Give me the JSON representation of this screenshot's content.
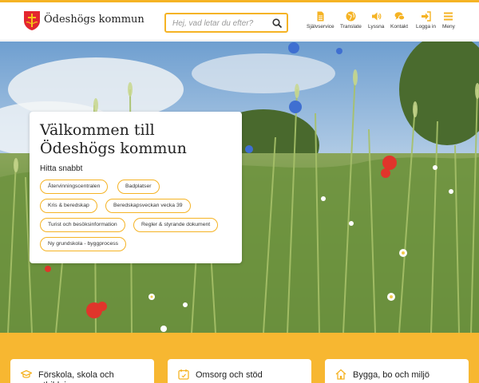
{
  "header": {
    "logo_text": "Ödeshögs kommun",
    "search_placeholder": "Hej, vad letar du efter?",
    "nav": [
      {
        "label": "Självservice",
        "icon": "document-icon"
      },
      {
        "label": "Translate",
        "icon": "globe-icon"
      },
      {
        "label": "Lyssna",
        "icon": "speaker-icon"
      },
      {
        "label": "Kontakt",
        "icon": "chat-icon"
      },
      {
        "label": "Logga in",
        "icon": "login-icon"
      },
      {
        "label": "Meny",
        "icon": "menu-icon"
      }
    ]
  },
  "hero": {
    "title": "Välkommen till Ödeshögs kommun",
    "subtitle": "Hitta snabbt",
    "chips": [
      "Återvinningscentralen",
      "Badplatser",
      "Kris & beredskap",
      "Beredskapsveckan vecka 39",
      "Turist och besöksinformation",
      "Regler & styrande dokument",
      "Ny grundskola - byggprocess"
    ]
  },
  "tiles": [
    {
      "label": "Förskola, skola och utbildning",
      "icon": "graduation-cap-icon"
    },
    {
      "label": "Omsorg och stöd",
      "icon": "calendar-care-icon"
    },
    {
      "label": "Bygga, bo och miljö",
      "icon": "house-icon"
    }
  ],
  "colors": {
    "accent": "#f5b324",
    "band": "#f7b731"
  }
}
